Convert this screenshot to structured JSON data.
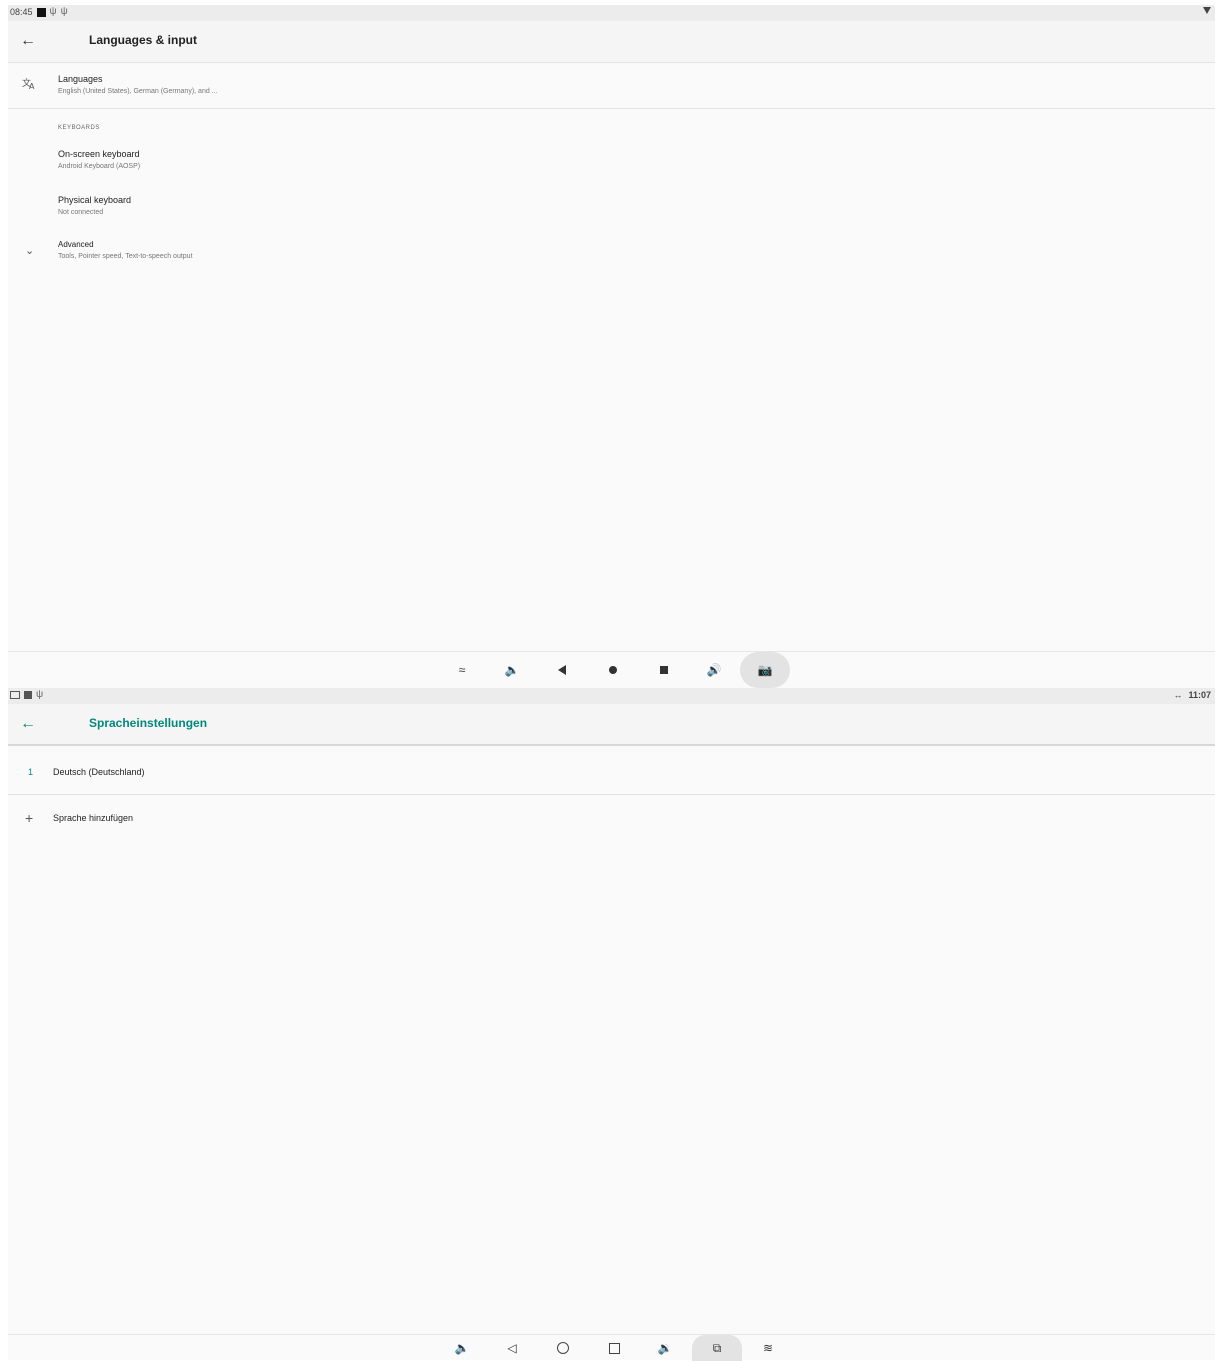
{
  "screen1": {
    "status_time": "08:45",
    "title": "Languages & input",
    "languages": {
      "title": "Languages",
      "summary": "English (United States), German (Germany), and ..."
    },
    "section_header": "KEYBOARDS",
    "onscreen": {
      "title": "On-screen keyboard",
      "summary": "Android Keyboard (AOSP)"
    },
    "physical": {
      "title": "Physical keyboard",
      "summary": "Not connected"
    },
    "advanced": {
      "title": "Advanced",
      "summary": "Tools, Pointer speed, Text-to-speech output"
    }
  },
  "screen2": {
    "status_time": "11:07",
    "status_arrows": "↔",
    "title": "Spracheinstellungen",
    "languages": [
      {
        "num": "1",
        "name": "Deutsch (Deutschland)"
      }
    ],
    "add_language": "Sprache hinzufügen"
  },
  "colors": {
    "accent": "#00897b"
  }
}
